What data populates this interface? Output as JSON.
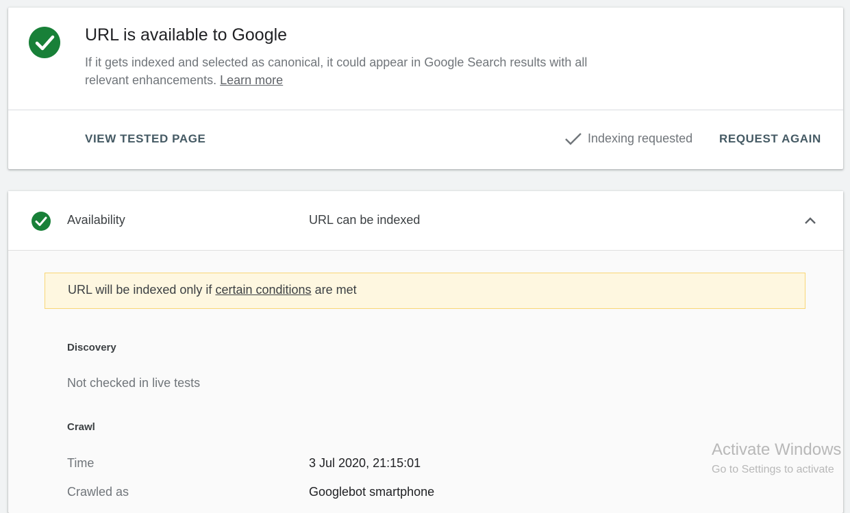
{
  "summary": {
    "title": "URL is available to Google",
    "description": "If it gets indexed and selected as canonical, it could appear in Google Search results with all relevant enhancements.",
    "learn_more": "Learn more",
    "view_tested_page": "VIEW TESTED PAGE",
    "indexing_status": "Indexing requested",
    "request_again": "REQUEST AGAIN",
    "status_color": "#188038"
  },
  "availability": {
    "label": "Availability",
    "value": "URL can be indexed",
    "warning": {
      "prefix": "URL will be indexed only if",
      "link": "certain conditions",
      "suffix": "are met"
    },
    "discovery": {
      "heading": "Discovery",
      "note": "Not checked in live tests"
    },
    "crawl": {
      "heading": "Crawl",
      "rows": [
        {
          "label": "Time",
          "value": "3 Jul 2020, 21:15:01"
        },
        {
          "label": "Crawled as",
          "value": "Googlebot smartphone"
        }
      ]
    }
  },
  "watermark": {
    "title": "Activate Windows",
    "subtitle": "Go to Settings to activate"
  }
}
